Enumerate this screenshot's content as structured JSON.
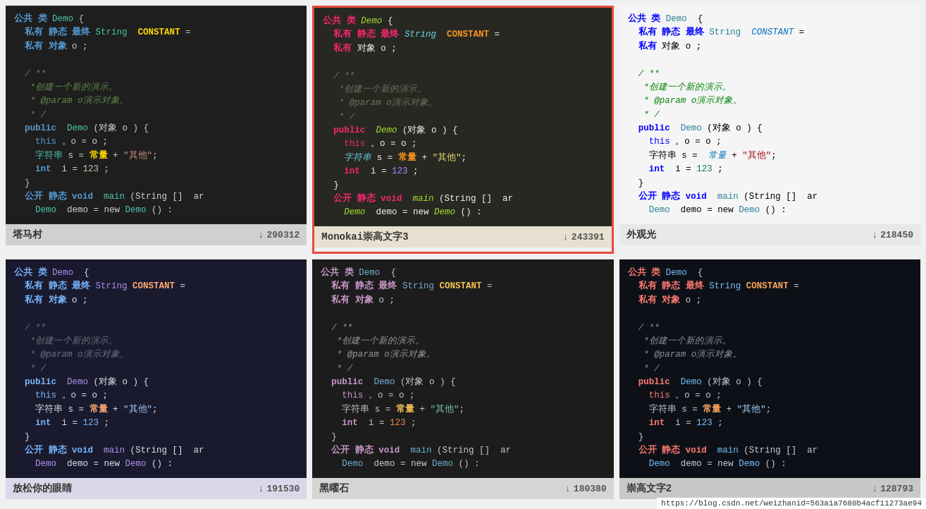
{
  "cards": [
    {
      "id": "tamacun",
      "name": "塔马村",
      "theme": "tamacun",
      "selected": false,
      "download_count": "290312",
      "bg": "#1e1e1e"
    },
    {
      "id": "monokai",
      "name": "Monokai崇高文字3",
      "theme": "monokai",
      "selected": true,
      "download_count": "243391",
      "bg": "#272822"
    },
    {
      "id": "waiguan",
      "name": "外观光",
      "theme": "waiguan",
      "selected": false,
      "download_count": "218450",
      "bg": "#f5f5f5"
    },
    {
      "id": "fangsong",
      "name": "放松你的眼睛",
      "theme": "fangsong",
      "selected": false,
      "download_count": "191530",
      "bg": "#1a1a2e"
    },
    {
      "id": "heiyao",
      "name": "黑曜石",
      "theme": "heiyao",
      "selected": false,
      "download_count": "180380",
      "bg": "#1c1c1c"
    },
    {
      "id": "chonggao2",
      "name": "崇高文字2",
      "theme": "chonggao2",
      "selected": false,
      "download_count": "128793",
      "bg": "#0d1117"
    }
  ],
  "url": "https://blog.csdn.net/weizhanid=563a1a7680b4acf11273ae94"
}
